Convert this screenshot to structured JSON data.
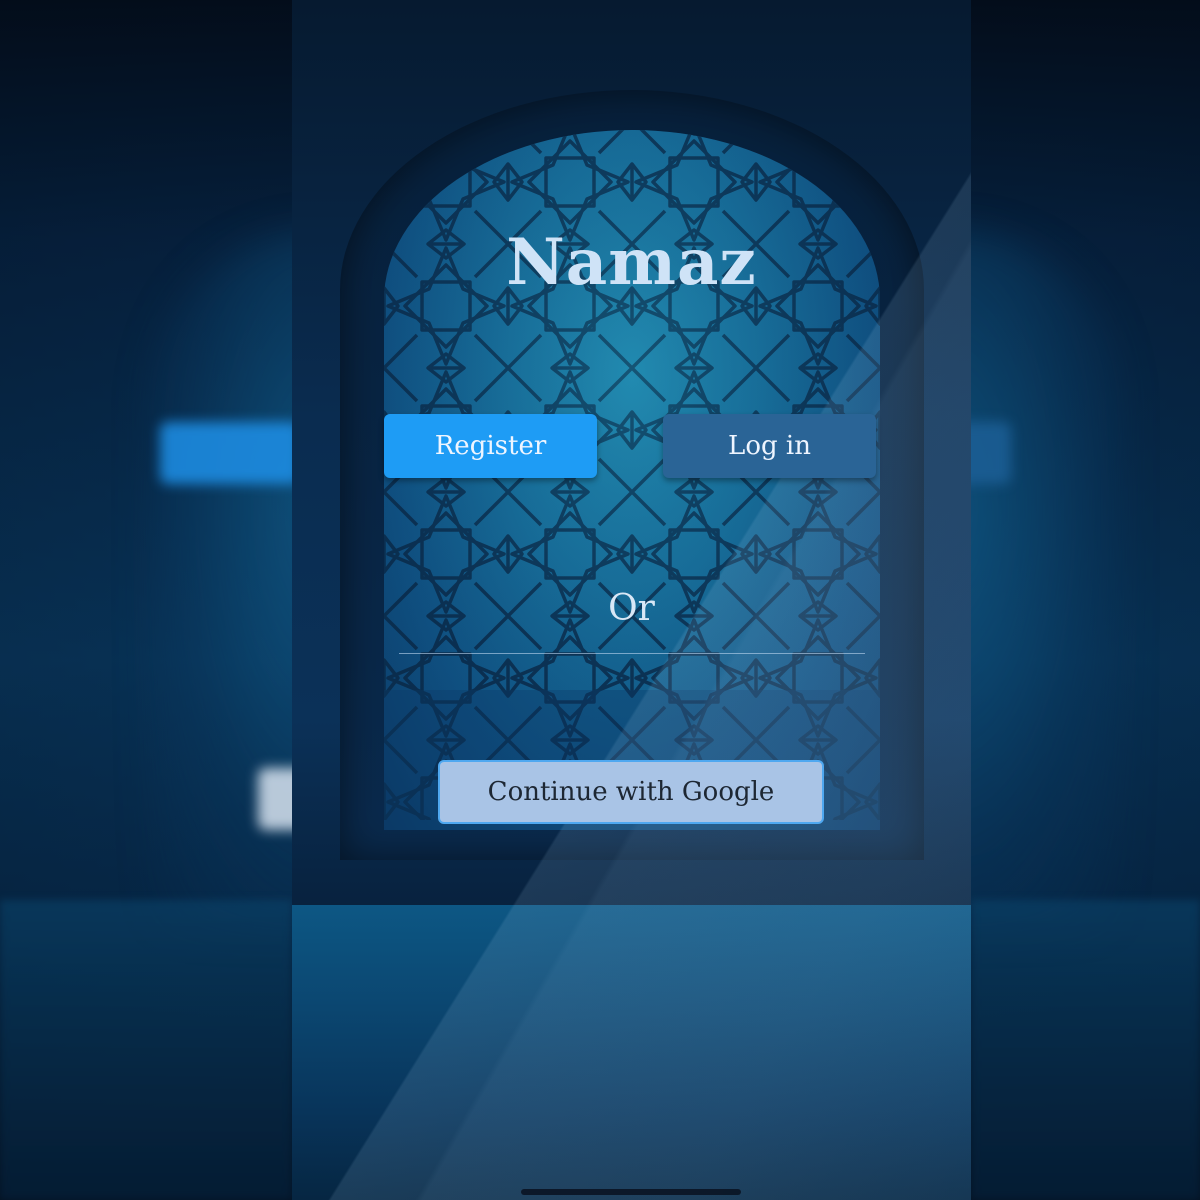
{
  "app": {
    "title": "Namaz"
  },
  "auth": {
    "register_label": "Register",
    "login_label": "Log in",
    "separator_label": "Or",
    "google_label": "Continue with Google"
  },
  "colors": {
    "register_button": "#1e9cf5",
    "login_button": "#2a6496",
    "google_button": "#a9c4e6",
    "google_button_border": "#4fa8f0",
    "title_text": "#cfe3f7"
  }
}
